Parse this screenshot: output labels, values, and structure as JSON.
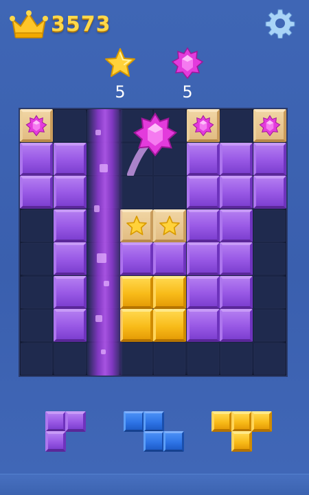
{
  "header": {
    "score": "3573",
    "crown_icon": "crown-icon",
    "settings_icon": "gear-icon"
  },
  "goals": [
    {
      "icon": "star-icon",
      "count": "5"
    },
    {
      "icon": "gem-icon",
      "count": "5"
    }
  ],
  "board": {
    "cols": 8,
    "rows": 8,
    "cells": [
      [
        "crate-gem",
        "",
        "",
        "",
        "",
        "crate-gem",
        "",
        "crate-gem"
      ],
      [
        "purple",
        "purple",
        "",
        "",
        "",
        "purple",
        "purple",
        "purple"
      ],
      [
        "purple",
        "purple",
        "",
        "",
        "",
        "purple",
        "purple",
        "purple"
      ],
      [
        "",
        "purple",
        "",
        "crate-star",
        "crate-star",
        "purple",
        "purple",
        ""
      ],
      [
        "",
        "purple",
        "",
        "purple",
        "purple",
        "purple",
        "purple",
        ""
      ],
      [
        "",
        "purple",
        "",
        "yellow",
        "yellow",
        "purple",
        "purple",
        ""
      ],
      [
        "",
        "purple",
        "",
        "yellow",
        "yellow",
        "purple",
        "purple",
        ""
      ],
      [
        "",
        "",
        "",
        "",
        "",
        "",
        "",
        ""
      ]
    ]
  },
  "pieces": [
    {
      "color": "purple",
      "cells": [
        [
          0,
          0
        ],
        [
          1,
          0
        ],
        [
          0,
          1
        ]
      ]
    },
    {
      "color": "blue",
      "cells": [
        [
          0,
          0
        ],
        [
          1,
          0
        ],
        [
          1,
          1
        ],
        [
          2,
          1
        ]
      ]
    },
    {
      "color": "yellow",
      "cells": [
        [
          0,
          0
        ],
        [
          1,
          0
        ],
        [
          2,
          0
        ],
        [
          1,
          1
        ]
      ]
    }
  ],
  "colors": {
    "purple": "#9a5ae6",
    "yellow": "#f8bb19",
    "blue": "#2e74e6",
    "score_gold": "#ffd84a",
    "background": "#3f66b5"
  }
}
